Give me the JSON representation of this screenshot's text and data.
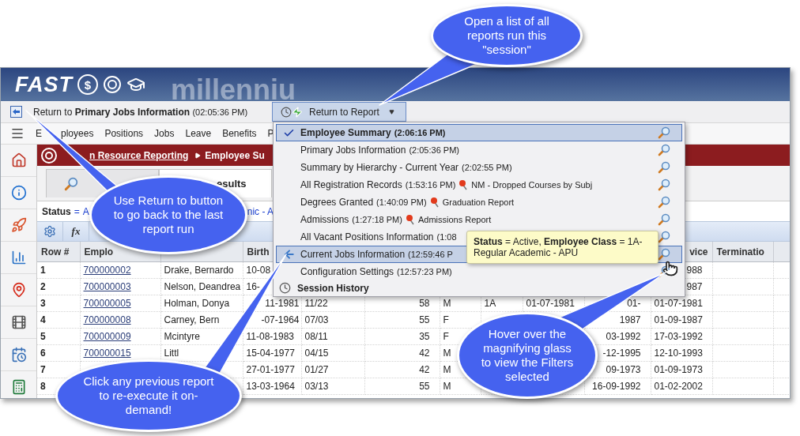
{
  "logo": {
    "name": "FAST",
    "badge": "$",
    "watermark": "millenniu"
  },
  "return_link": {
    "label": "Return to **Primary Jobs Information**",
    "time": "(02:05:36 PM)"
  },
  "return_button": {
    "label": "Return to Report"
  },
  "menu": [
    {
      "prefix": "E",
      "label": "ployees"
    },
    {
      "label": "Positions"
    },
    {
      "label": "Jobs"
    },
    {
      "label": "Leave"
    },
    {
      "label": "Benefits"
    },
    {
      "label": "P"
    }
  ],
  "breadcrumb": [
    {
      "label": "n Resource Reporting",
      "kind": "link"
    },
    {
      "label": "Employee Su",
      "kind": "current"
    }
  ],
  "tabs": [
    {
      "selected": false
    },
    {
      "label": "esults",
      "selected": true
    }
  ],
  "status": {
    "label": "Status",
    "operator": "=",
    "value": "A",
    "value_2": "nic - A"
  },
  "formula_button": "fx",
  "table": {
    "columns": [
      "Row #",
      "Emplo",
      null,
      "Birth",
      null,
      null,
      null,
      null,
      null,
      null,
      "vice",
      "Terminatio"
    ],
    "rows": [
      {
        "cells": [
          "1",
          "700000002",
          "Drake, Bernardo",
          "10-08",
          null,
          null,
          null,
          null,
          null,
          null,
          "988",
          null
        ]
      },
      {
        "cells": [
          "2",
          "700000003",
          "Nelson, Deandrea",
          "16-",
          null,
          null,
          null,
          null,
          null,
          null,
          "987",
          null
        ]
      },
      {
        "cells": [
          "3",
          "700000005",
          "Holman, Donya",
          "11-1981",
          "11/22",
          "58",
          "M",
          "1A",
          "01-07-1981",
          "01-",
          "01-07-1981",
          null
        ],
        "birth_start_hidden": true
      },
      {
        "cells": [
          "4",
          "700000008",
          "Carney, Bern",
          "-07-1964",
          "07/03",
          "55",
          "F",
          null,
          null,
          "1987",
          "01-09-1987",
          null
        ],
        "birth_start_hidden": true
      },
      {
        "cells": [
          "5",
          "700000009",
          "Mcintyre",
          "11-08-1983",
          "08/11",
          "35",
          "F",
          null,
          null,
          "03-1992",
          "17-03-1992",
          null
        ]
      },
      {
        "cells": [
          "6",
          "700000015",
          "Littl",
          "15-04-1977",
          "04/15",
          "42",
          "M",
          null,
          null,
          "-12-1995",
          "12-10-1993",
          null
        ]
      },
      {
        "cells": [
          "7",
          null,
          null,
          "27-01-1977",
          "01/27",
          "42",
          "M",
          null,
          null,
          "09-1973",
          "01-09-1973",
          null
        ]
      },
      {
        "cells": [
          "8",
          null,
          null,
          "13-03-1964",
          "03/13",
          "55",
          "M",
          null,
          null,
          "16-09-1992",
          "01-02-2002",
          null
        ]
      }
    ]
  },
  "recent_reports": {
    "items": [
      {
        "label": "Employee Summary",
        "time": "(2:06:16 PM)",
        "kind": "check",
        "selected": true,
        "hovered": false
      },
      {
        "label": "Primary Jobs Information",
        "time": "(2:05:36 PM)",
        "kind": "plain",
        "selected": false,
        "hovered": false
      },
      {
        "label": "Summary by Hierarchy - Current Year",
        "time": "(2:02:55 PM)",
        "kind": "plain",
        "selected": false,
        "hovered": false
      },
      {
        "label": "All Registration Records",
        "time": "(1:53:16 PM)",
        "note": "NM - Dropped Courses by Subj",
        "kind": "plain",
        "selected": false,
        "hovered": false
      },
      {
        "label": "Degrees Granted",
        "time": "(1:40:09 PM)",
        "note": "Graduation Report",
        "kind": "plain",
        "selected": false,
        "hovered": false
      },
      {
        "label": "Admissions",
        "time": "(1:27:18 PM)",
        "note": "Admissions Report",
        "kind": "plain",
        "selected": false,
        "hovered": false
      },
      {
        "label": "All Vacant Positions Information",
        "time": "(1:08",
        "kind": "plain",
        "selected": false,
        "hovered": false
      },
      {
        "label": "Current Jobs Information",
        "time": "(12:59:46 P",
        "kind": "back",
        "selected": false,
        "hovered": true
      },
      {
        "label": "Configuration Settings",
        "time": "(12:57:23 PM)",
        "kind": "plain",
        "selected": false,
        "hovered": false
      }
    ],
    "footer": "Session History"
  },
  "tooltip": "**Status** = Active, **Employee Class** = 1A-Regular Academic - APU",
  "callouts": [
    {
      "text": "Open a list of all reports run this \"session\""
    },
    {
      "text": "Use Return to button to go back to the last report run"
    },
    {
      "text": "Click any previous report to re-execute it on-demand!"
    },
    {
      "text": "Hover over the magnifying glass to view the Filters selected"
    }
  ]
}
